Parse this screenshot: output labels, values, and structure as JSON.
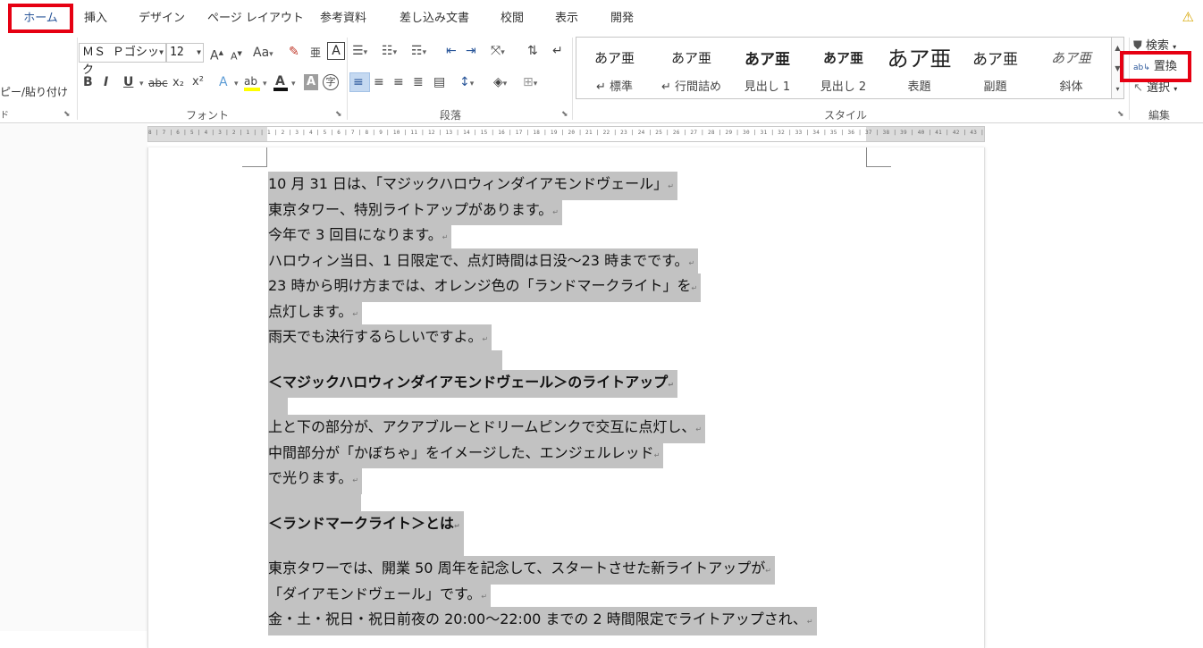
{
  "tabs": [
    "ホーム",
    "挿入",
    "デザイン",
    "ページ レイアウト",
    "参考資料",
    "差し込み文書",
    "校閲",
    "表示",
    "開発"
  ],
  "clipboard": {
    "paste_label": "ピー/貼り付け",
    "group_label": "ド"
  },
  "font": {
    "name": "ＭＳ Ｐゴシック",
    "size": "12",
    "group_label": "フォント",
    "grow": "A",
    "shrink": "A",
    "case": "Aa",
    "box_char": "A",
    "furigana": "亜",
    "bold": "B",
    "italic": "I",
    "underline": "U",
    "strike": "abc",
    "sub": "x₂",
    "sup": "x²",
    "effect": "A",
    "highlight": "ab",
    "color": "A",
    "shade": "A",
    "enclose": "字"
  },
  "paragraph": {
    "group_label": "段落"
  },
  "styles": {
    "group_label": "スタイル",
    "items": [
      {
        "preview": "あア亜",
        "name": "↵ 標準"
      },
      {
        "preview": "あア亜",
        "name": "↵ 行間詰め"
      },
      {
        "preview": "あア亜",
        "name": "見出し 1"
      },
      {
        "preview": "あア亜",
        "name": "見出し 2"
      },
      {
        "preview": "あア亜",
        "name": "表題"
      },
      {
        "preview": "あア亜",
        "name": "副題"
      },
      {
        "preview": "あア亜",
        "name": "斜体"
      }
    ]
  },
  "editing": {
    "group_label": "編集",
    "find": "検索",
    "replace": "置換",
    "select": "選択"
  },
  "ruler_text": "8 | 7 | 6 | 5 | 4 | 3 | 2 | 1 |   | 1 | 2 | 3 | 4 | 5 | 6 | 7 | 8 | 9 | 10 | 11 | 12 | 13 | 14 | 15 | 16 | 17 | 18 | 19 | 20 | 21 | 22 | 23 | 24 | 25 | 26 | 27 | 28 | 29 | 30 | 31 | 32 | 33 | 34 | 35 | 36 | 37 | 38 | 39 | 40 | 41 | 42 | 43 | 44 | 45 | 46 | 47 | 48",
  "document": {
    "lines": [
      "10 月 31 日は、「マジックハロウィンダイアモンドヴェール」",
      "東京タワー、特別ライトアップがあります。",
      "今年で 3 回目になります。",
      "ハロウィン当日、1 日限定で、点灯時間は日没～23 時までです。",
      "23 時から明け方までは、オレンジ色の「ランドマークライト」を",
      "点灯します。",
      "雨天でも決行するらしいですよ。",
      "",
      "＜マジックハロウィンダイアモンドヴェール＞のライトアップ",
      "",
      "上と下の部分が、アクアブルーとドリームピンクで交互に点灯し、",
      "中間部分が「かぼちゃ」をイメージした、エンジェルレッド",
      "で光ります。",
      "",
      "＜ランドマークライト＞とは",
      "",
      "東京タワーでは、開業 50 周年を記念して、スタートさせた新ライトアップが",
      "「ダイアモンドヴェール」です。",
      "金・土・祝日・祝日前夜の 20:00～22:00 までの 2 時間限定でライトアップされ、"
    ]
  },
  "colors": {
    "accent": "#2b579a",
    "highlight_box": "#e60012",
    "selection": "#c2c2c2"
  }
}
